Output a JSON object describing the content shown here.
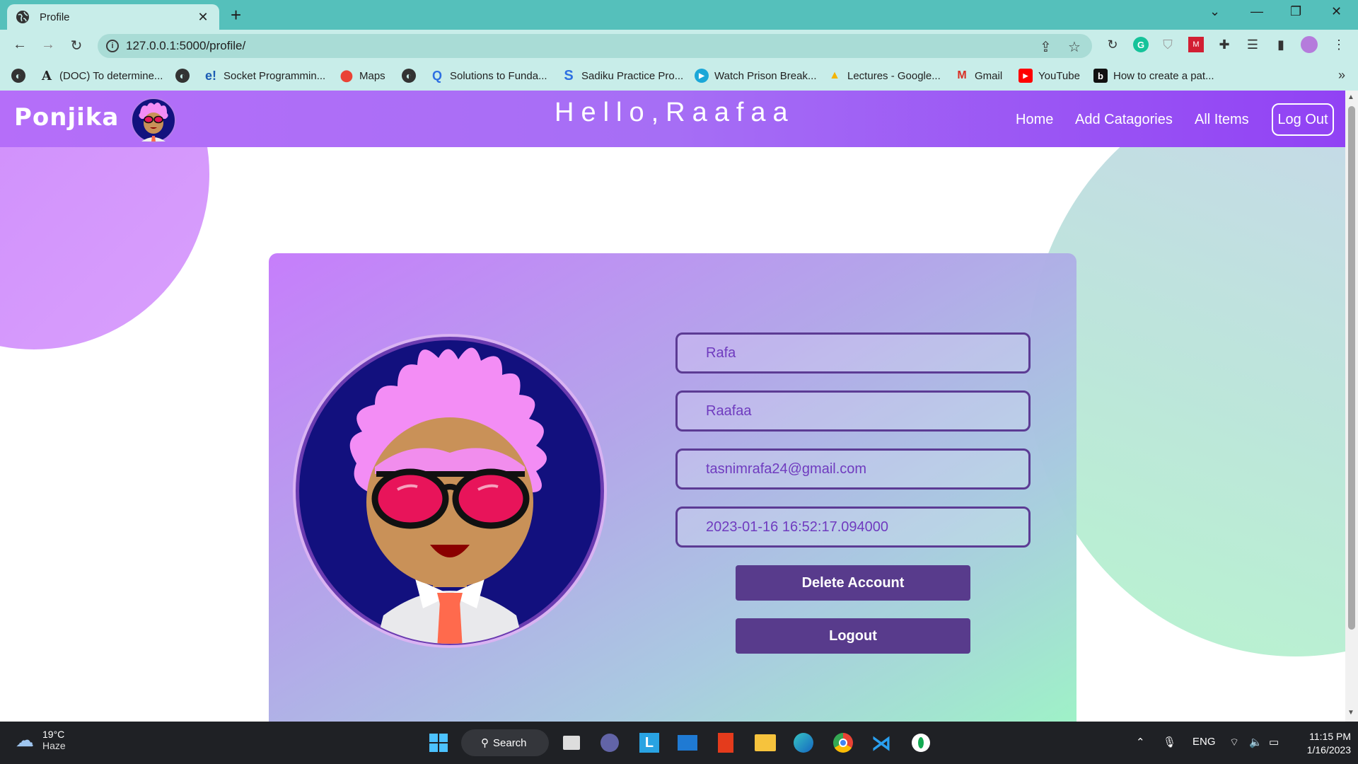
{
  "browser": {
    "tab_title": "Profile",
    "url": "127.0.0.1:5000/profile/",
    "bookmarks": [
      {
        "label": "(DOC) To determine...",
        "icon": "academia-icon"
      },
      {
        "label": "Socket Programmin...",
        "icon": "e-icon"
      },
      {
        "label": "Maps",
        "icon": "maps-pin-icon"
      },
      {
        "label": "Solutions to Funda...",
        "icon": "q-icon"
      },
      {
        "label": "Sadiku Practice Pro...",
        "icon": "s-icon"
      },
      {
        "label": "Watch Prison Break...",
        "icon": "play-icon"
      },
      {
        "label": "Lectures - Google...",
        "icon": "drive-icon"
      },
      {
        "label": "Gmail",
        "icon": "gmail-icon"
      },
      {
        "label": "YouTube",
        "icon": "youtube-icon"
      },
      {
        "label": "How to create a pat...",
        "icon": "b-icon"
      }
    ]
  },
  "navbar": {
    "logo": "Ponjika",
    "greeting": "Hello,Raafaa",
    "links": [
      "Home",
      "Add Catagories",
      "All Items"
    ],
    "logout_label": "Log Out"
  },
  "profile": {
    "first_name": "Rafa",
    "username": "Raafaa",
    "email": "tasnimrafa24@gmail.com",
    "joined": "2023-01-16 16:52:17.094000",
    "delete_label": "Delete Account",
    "logout_label": "Logout"
  },
  "taskbar": {
    "temperature": "19°C",
    "condition": "Haze",
    "search_label": "Search",
    "language": "ENG",
    "time": "11:15 PM",
    "date": "1/16/2023"
  },
  "colors": {
    "tab_bar": "#55c0bb",
    "chrome_light": "#c8ede9",
    "navbar": "#a66ef5",
    "button": "#583b8c",
    "field_text": "#6f3bbf"
  }
}
